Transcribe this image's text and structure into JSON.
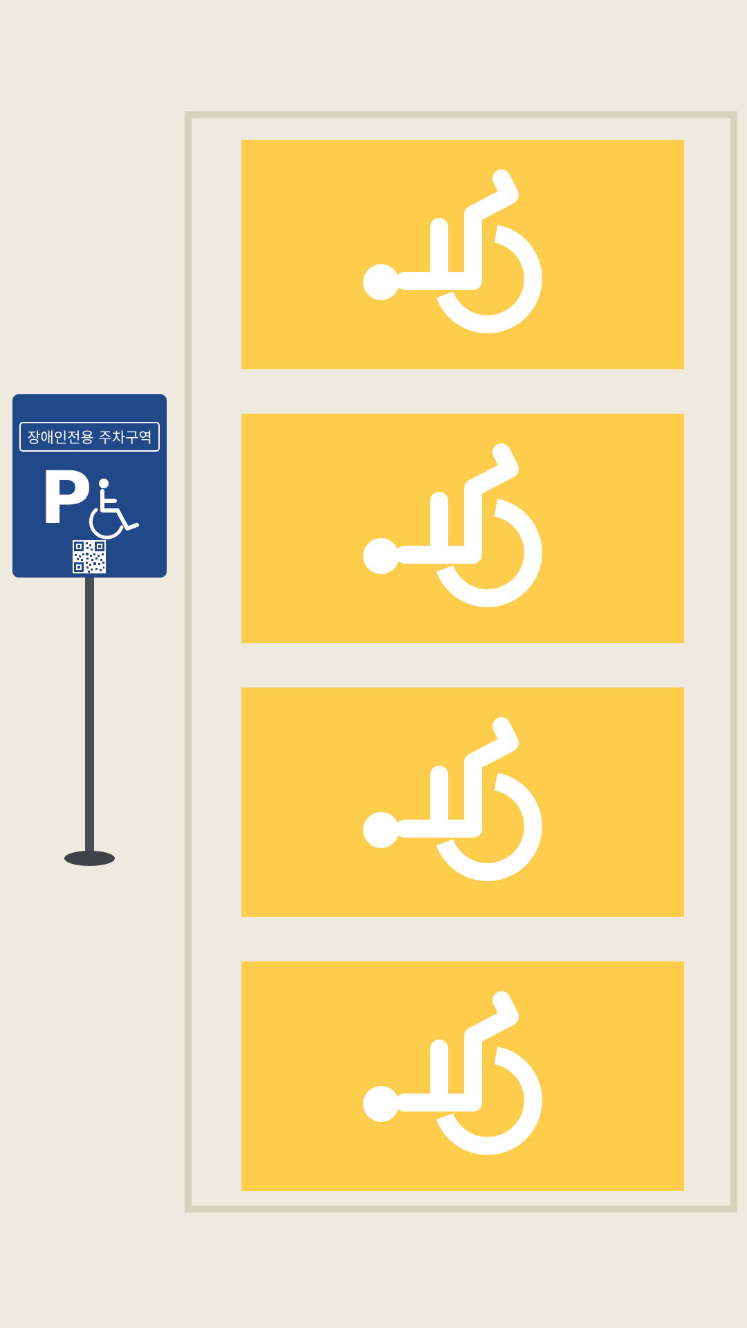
{
  "sign": {
    "title": "장애인전용 주차구역",
    "letter": "P",
    "icon": "wheelchair-icon",
    "qr": "qr-code"
  },
  "bays": [
    {
      "icon": "wheelchair-icon"
    },
    {
      "icon": "wheelchair-icon"
    },
    {
      "icon": "wheelchair-icon"
    },
    {
      "icon": "wheelchair-icon"
    }
  ],
  "colors": {
    "ground": "#eeeae0",
    "frame_line": "#d5d2bd",
    "bay_fill": "#fecd4c",
    "symbol": "#ffffff",
    "sign_blue": "#214989",
    "pole": "#4b4e55"
  }
}
